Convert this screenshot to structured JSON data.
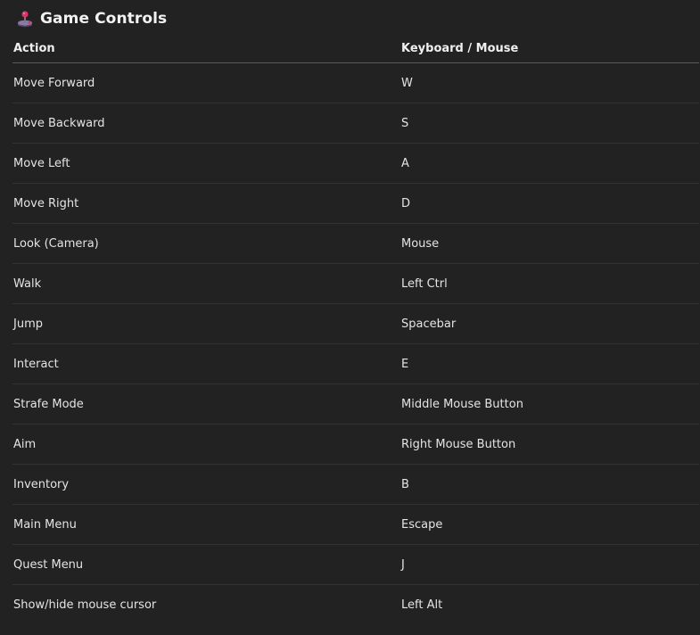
{
  "header": {
    "title": "Game Controls",
    "icon": "joystick-icon"
  },
  "table": {
    "columns": [
      "Action",
      "Keyboard / Mouse"
    ],
    "rows": [
      {
        "action": "Move Forward",
        "key": "W"
      },
      {
        "action": "Move Backward",
        "key": "S"
      },
      {
        "action": "Move Left",
        "key": "A"
      },
      {
        "action": "Move Right",
        "key": "D"
      },
      {
        "action": "Look (Camera)",
        "key": "Mouse"
      },
      {
        "action": "Walk",
        "key": "Left Ctrl"
      },
      {
        "action": "Jump",
        "key": "Spacebar"
      },
      {
        "action": "Interact",
        "key": "E"
      },
      {
        "action": "Strafe Mode",
        "key": "Middle Mouse Button"
      },
      {
        "action": "Aim",
        "key": "Right Mouse Button"
      },
      {
        "action": "Inventory",
        "key": "B"
      },
      {
        "action": "Main Menu",
        "key": "Escape"
      },
      {
        "action": "Quest Menu",
        "key": "J"
      },
      {
        "action": "Show/hide mouse cursor",
        "key": "Left Alt"
      }
    ]
  },
  "colors": {
    "background": "#222222",
    "text": "#e4e4e4",
    "header_rule": "#5a5a5a",
    "row_rule": "#333333"
  }
}
